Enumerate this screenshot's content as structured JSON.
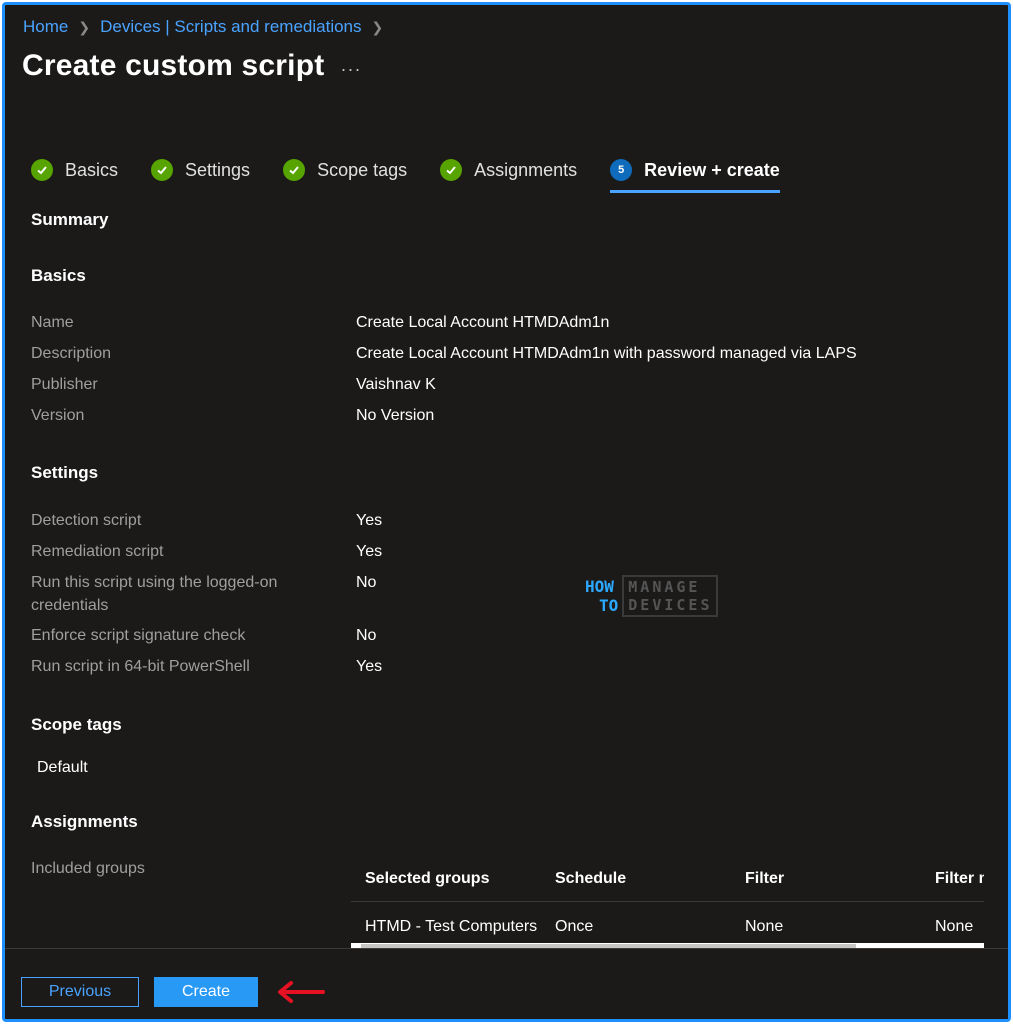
{
  "breadcrumb": {
    "items": [
      "Home",
      "Devices | Scripts and remediations"
    ]
  },
  "page": {
    "title": "Create custom script",
    "more": "..."
  },
  "tabs": [
    {
      "label": "Basics",
      "state": "complete"
    },
    {
      "label": "Settings",
      "state": "complete"
    },
    {
      "label": "Scope tags",
      "state": "complete"
    },
    {
      "label": "Assignments",
      "state": "complete"
    },
    {
      "label": "Review + create",
      "state": "active",
      "step": "5"
    }
  ],
  "summary": {
    "heading": "Summary"
  },
  "basics": {
    "heading": "Basics",
    "rows": [
      {
        "label": "Name",
        "value": "Create Local Account HTMDAdm1n"
      },
      {
        "label": "Description",
        "value": "Create Local Account HTMDAdm1n with password managed via LAPS"
      },
      {
        "label": "Publisher",
        "value": "Vaishnav K"
      },
      {
        "label": "Version",
        "value": "No Version"
      }
    ]
  },
  "settings": {
    "heading": "Settings",
    "rows": [
      {
        "label": "Detection script",
        "value": "Yes"
      },
      {
        "label": "Remediation script",
        "value": "Yes"
      },
      {
        "label": "Run this script using the logged-on credentials",
        "value": "No"
      },
      {
        "label": "Enforce script signature check",
        "value": "No"
      },
      {
        "label": "Run script in 64-bit PowerShell",
        "value": "Yes"
      }
    ]
  },
  "scope_tags": {
    "heading": "Scope tags",
    "value": "Default"
  },
  "assignments": {
    "heading": "Assignments",
    "included_label": "Included groups",
    "columns": [
      "Selected groups",
      "Schedule",
      "Filter",
      "Filter m"
    ],
    "rows": [
      [
        "HTMD - Test Computers",
        "Once",
        "None",
        "None"
      ]
    ]
  },
  "watermark": {
    "left_top": "HOW",
    "left_bottom": "TO",
    "right_top": "MANAGE",
    "right_bottom": "DEVICES"
  },
  "footer": {
    "previous_label": "Previous",
    "create_label": "Create"
  },
  "colors": {
    "background": "#1b1a19",
    "accent": "#4aa3ff",
    "primary_button": "#2899f5",
    "success": "#57a300",
    "annotation_arrow": "#e81123",
    "frame_border": "#1e90ff"
  }
}
